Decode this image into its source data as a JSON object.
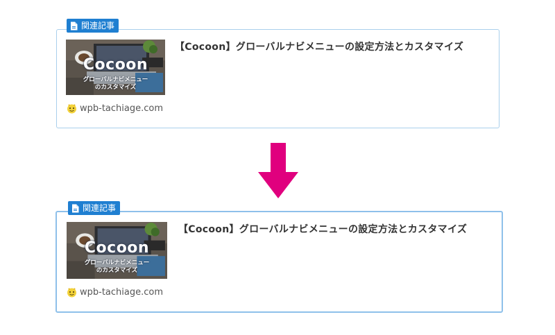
{
  "colors": {
    "label_bg": "#1f7fd1",
    "border_top": "#a9cfec",
    "border_bottom": "#8ec0ea",
    "arrow": "#e0007e"
  },
  "cards": [
    {
      "label": "関連記事",
      "label_icon": "document-icon",
      "thumbnail": {
        "title": "Cocoon",
        "subtitle_line1": "グローバルナビメニュー",
        "subtitle_line2": "のカスタマイズ"
      },
      "title": "【Cocoon】グローバルナビメニューの設定方法とカスタマイズ",
      "site_icon": "favicon-icon",
      "site": "wpb-tachiage.com"
    },
    {
      "label": "関連記事",
      "label_icon": "document-icon",
      "thumbnail": {
        "title": "Cocoon",
        "subtitle_line1": "グローバルナビメニュー",
        "subtitle_line2": "のカスタマイズ"
      },
      "title": "【Cocoon】グローバルナビメニューの設定方法とカスタマイズ",
      "site_icon": "favicon-icon",
      "site": "wpb-tachiage.com"
    }
  ],
  "arrow_icon": "arrow-down-icon"
}
